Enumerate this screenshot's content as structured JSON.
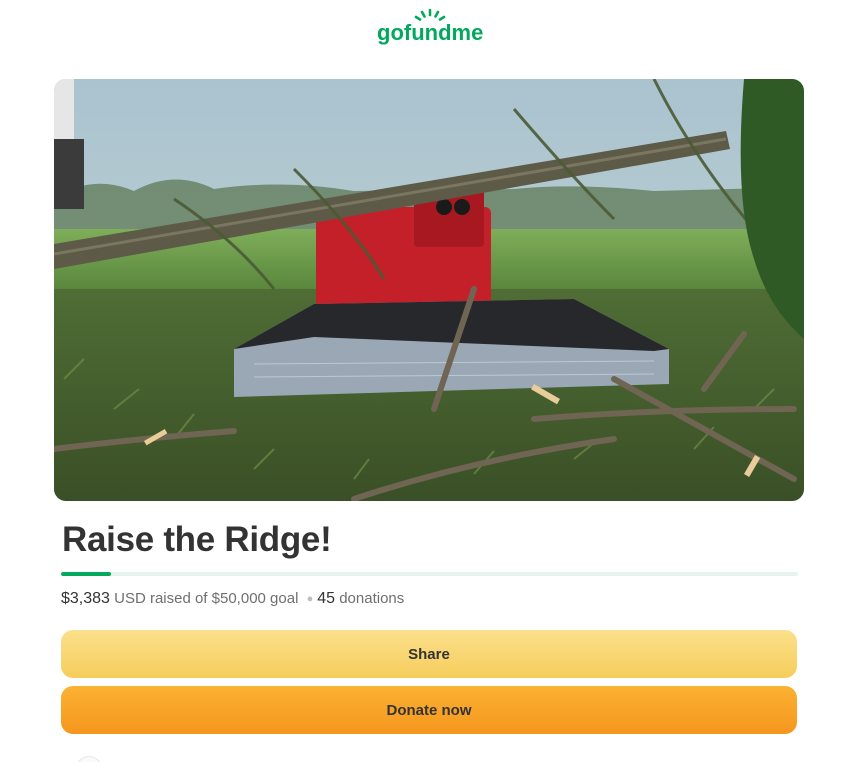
{
  "brand": {
    "logo_text": "gofundme",
    "color": "#02a95c"
  },
  "hero": {
    "icon": "hero-photo"
  },
  "campaign": {
    "title": "Raise the Ridge!",
    "progress_fraction": 0.0677,
    "raised_amount": "$3,383",
    "raised_currency": "USD raised of",
    "goal": "$50,000 goal",
    "separator": "●",
    "donations_count": "45",
    "donations_label": "donations"
  },
  "actions": {
    "share_label": "Share",
    "donate_label": "Donate now"
  },
  "colors": {
    "progress_fill": "#02a95c",
    "progress_track": "#e6f3ee",
    "share_bg": "#f6cd5c",
    "donate_bg": "#f5961e"
  }
}
